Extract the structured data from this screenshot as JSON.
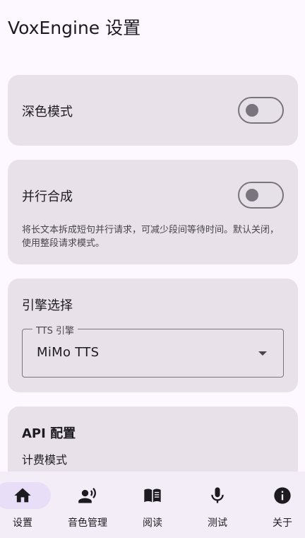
{
  "header": {
    "title": "VoxEngine 设置"
  },
  "settings": {
    "dark_mode": {
      "label": "深色模式",
      "enabled": false
    },
    "parallel": {
      "label": "并行合成",
      "enabled": false,
      "description": "将长文本拆成短句并行请求，可减少段间等待时间。默认关闭，使用整段请求模式。"
    },
    "engine": {
      "section_label": "引擎选择",
      "field_label": "TTS 引擎",
      "selected": "MiMo TTS"
    },
    "api": {
      "title": "API 配置",
      "billing_label": "计费模式"
    }
  },
  "nav": {
    "items": [
      {
        "label": "设置",
        "icon": "home-icon",
        "active": true
      },
      {
        "label": "音色管理",
        "icon": "voice-person-icon",
        "active": false
      },
      {
        "label": "阅读",
        "icon": "book-icon",
        "active": false
      },
      {
        "label": "测试",
        "icon": "mic-icon",
        "active": false
      },
      {
        "label": "关于",
        "icon": "info-icon",
        "active": false
      }
    ]
  },
  "colors": {
    "background": "#fdf7ff",
    "card": "#e8e1ea",
    "outline": "#79747e",
    "nav_bg": "#f3edf7",
    "nav_active": "#e8def8"
  }
}
